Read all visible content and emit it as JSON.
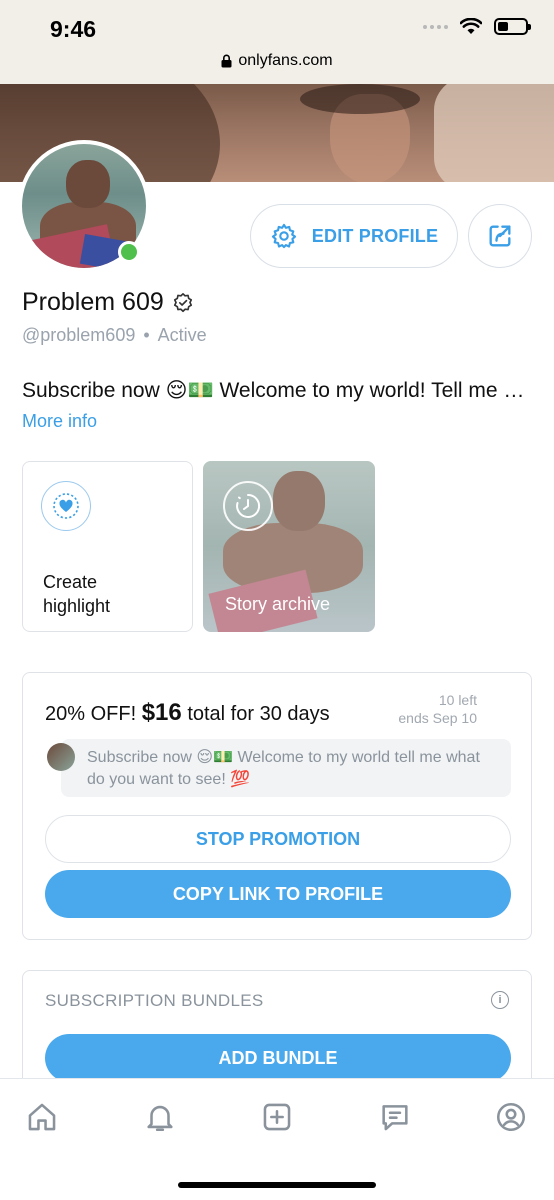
{
  "status_bar": {
    "time": "9:46"
  },
  "browser": {
    "url": "onlyfans.com"
  },
  "profile": {
    "edit_label": "EDIT PROFILE",
    "name": "Problem 609",
    "handle": "@problem609",
    "separator": "•",
    "status": "Active",
    "bio": "Subscribe now 😌💵 Welcome to my world! Tell me what do you want to see! 💯",
    "more_info": "More info"
  },
  "highlights": {
    "create_label_line1": "Create",
    "create_label_line2": "highlight",
    "archive_label": "Story archive"
  },
  "promotion": {
    "discount": "20% OFF!",
    "price": "$16",
    "duration": "total for 30 days",
    "left": "10 left",
    "ends": "ends Sep 10",
    "message": "Subscribe now 😌💵 Welcome to my world tell me what do you want to see! 💯",
    "stop_label": "STOP PROMOTION",
    "copy_label": "COPY LINK TO PROFILE"
  },
  "bundles": {
    "title": "SUBSCRIPTION BUNDLES",
    "add_label": "ADD BUNDLE"
  },
  "nav": [
    "home-icon",
    "bell-icon",
    "add-post-icon",
    "messages-icon",
    "profile-icon"
  ],
  "colors": {
    "accent": "#3a9fe6",
    "button_fill": "#4aa9ec",
    "online": "#4fc04b"
  }
}
